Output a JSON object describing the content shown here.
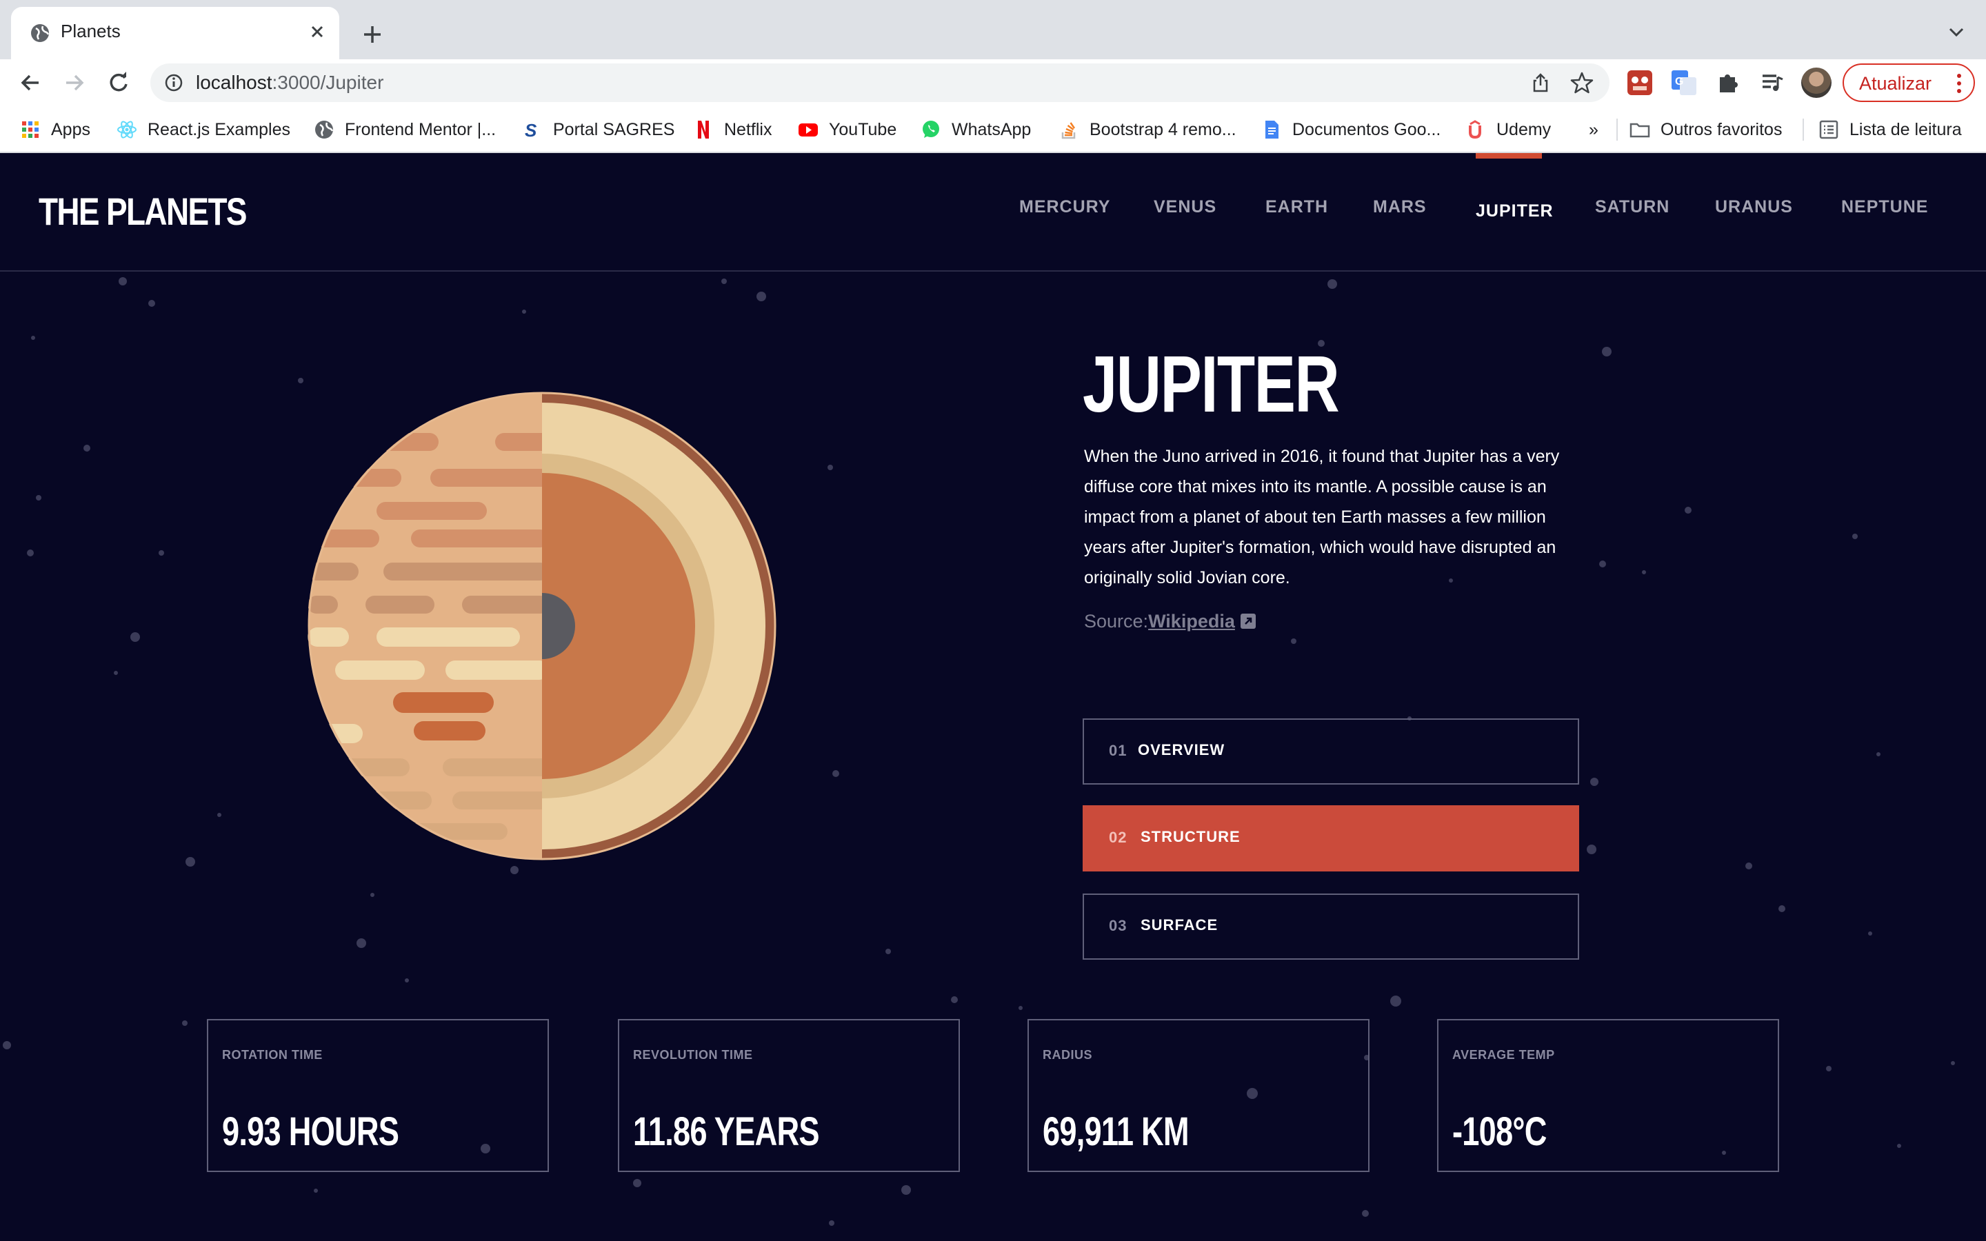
{
  "browser": {
    "tab_title": "Planets",
    "url_host": "localhost",
    "url_rest": ":3000/Jupiter",
    "update_label": "Atualizar",
    "bookmarks": [
      {
        "label": "Apps",
        "icon": "apps-grid-icon"
      },
      {
        "label": "React.js Examples",
        "icon": "react-icon"
      },
      {
        "label": "Frontend Mentor |...",
        "icon": "globe-icon"
      },
      {
        "label": "Portal SAGRES",
        "icon": "sagres-icon"
      },
      {
        "label": "Netflix",
        "icon": "netflix-icon"
      },
      {
        "label": "YouTube",
        "icon": "youtube-icon"
      },
      {
        "label": "WhatsApp",
        "icon": "whatsapp-icon"
      },
      {
        "label": "Bootstrap 4 remo...",
        "icon": "stackoverflow-icon"
      },
      {
        "label": "Documentos Goo...",
        "icon": "google-docs-icon"
      },
      {
        "label": "Udemy",
        "icon": "udemy-icon"
      }
    ],
    "overflow_label": "»",
    "other_bookmarks": "Outros favoritos",
    "reading_list": "Lista de leitura"
  },
  "site": {
    "logo": "THE PLANETS",
    "nav": [
      "MERCURY",
      "VENUS",
      "EARTH",
      "MARS",
      "JUPITER",
      "SATURN",
      "URANUS",
      "NEPTUNE"
    ],
    "active_nav": "JUPITER",
    "accent_color": "#D14C32"
  },
  "planet": {
    "name": "JUPITER",
    "description": "When the Juno arrived in 2016, it found that Jupiter has a very diffuse core that mixes into its mantle. A possible cause is an impact from a planet of about ten Earth masses a few million years after Jupiter's formation, which would have disrupted an originally solid Jovian core.",
    "source_label": "Source:",
    "source_link": "Wikipedia"
  },
  "tabs": [
    {
      "num": "01",
      "label": "OVERVIEW",
      "active": false
    },
    {
      "num": "02",
      "label": "STRUCTURE",
      "active": true
    },
    {
      "num": "03",
      "label": "SURFACE",
      "active": false
    }
  ],
  "stats": [
    {
      "label": "ROTATION TIME",
      "value": "9.93 HOURS"
    },
    {
      "label": "REVOLUTION TIME",
      "value": "11.86 YEARS"
    },
    {
      "label": "RADIUS",
      "value": "69,911 KM"
    },
    {
      "label": "AVERAGE TEMP",
      "value": "-108°C"
    }
  ]
}
